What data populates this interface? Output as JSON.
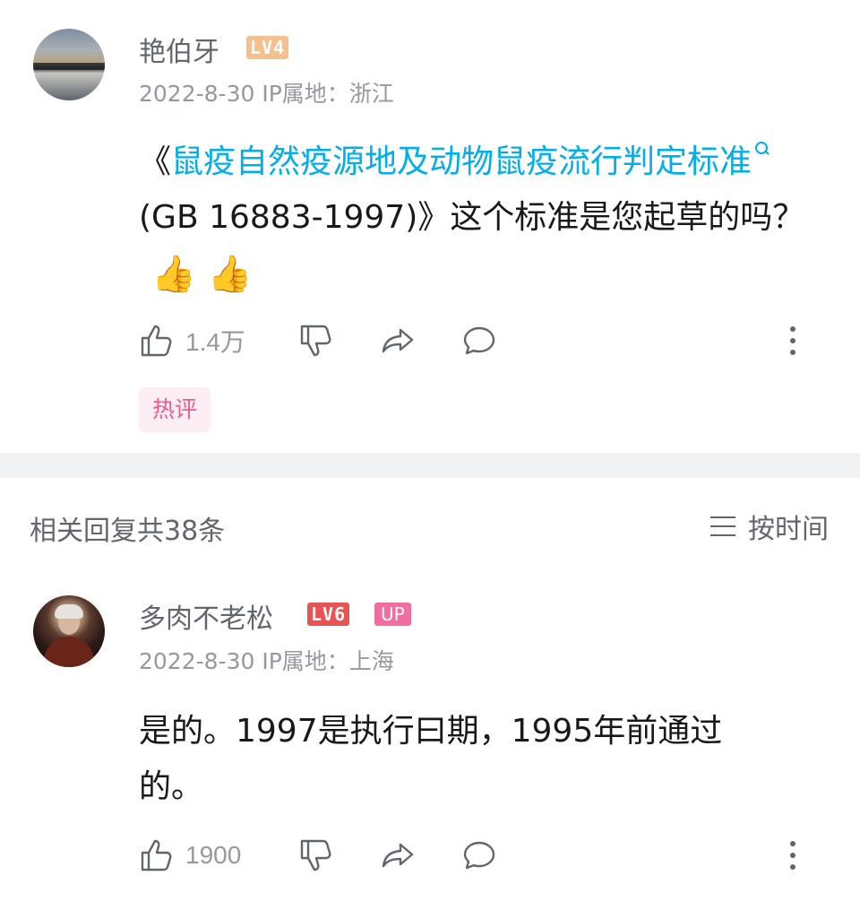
{
  "comment1": {
    "username": "艳伯牙",
    "level": "LV4",
    "date": "2022-8-30",
    "ip": "IP属地：浙江",
    "content_prefix": "《",
    "content_link": "鼠疫自然疫源地及动物鼠疫流行判定标准",
    "content_suffix": "(GB 16883-1997)》这个标准是您起草的吗？",
    "emoji": "👍 👍",
    "likes": "1.4万",
    "tag": "热评"
  },
  "replies": {
    "count_label": "相关回复共38条",
    "sort_label": "按时间"
  },
  "comment2": {
    "username": "多肉不老松",
    "level": "LV6",
    "badge": "UP",
    "date": "2022-8-30",
    "ip": "IP属地：上海",
    "content": "是的。1997是执行曰期，1995年前通过的。",
    "likes": "1900"
  },
  "icons": [
    "avatar",
    "search-icon",
    "thumb-up-icon",
    "thumb-down-icon",
    "share-icon",
    "comment-icon",
    "more-icon",
    "sort-icon"
  ],
  "colors": {
    "link": "#00aeec",
    "hot_tag_bg": "#fdeef3",
    "hot_tag_text": "#ef5b8c",
    "lv4": "#f3c08e",
    "lv6": "#e85454",
    "up": "#f06f9e"
  }
}
